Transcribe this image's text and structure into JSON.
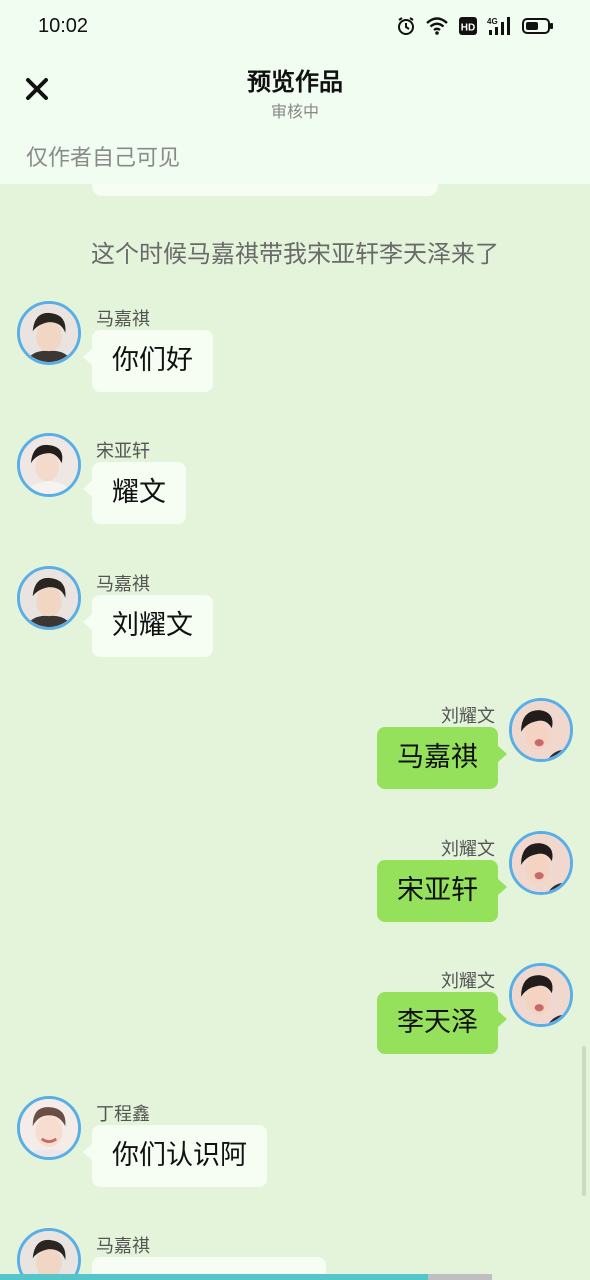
{
  "status_bar": {
    "time": "10:02",
    "icons": [
      "alarm-icon",
      "wifi-icon",
      "hd-icon",
      "signal-4g-icon",
      "battery-icon"
    ],
    "network_label": "4G",
    "hd_label": "HD"
  },
  "header": {
    "close_icon": "close-icon",
    "title": "预览作品",
    "subtitle": "审核中",
    "visibility_note": "仅作者自己可见"
  },
  "narration": "这个时候马嘉祺带我宋亚轩李天泽来了",
  "messages": [
    {
      "side": "left",
      "sender": "马嘉祺",
      "text": "你们好",
      "avatar": "avatar-majiaqi"
    },
    {
      "side": "left",
      "sender": "宋亚轩",
      "text": "耀文",
      "avatar": "avatar-songyaxuan"
    },
    {
      "side": "left",
      "sender": "马嘉祺",
      "text": "刘耀文",
      "avatar": "avatar-majiaqi"
    },
    {
      "side": "right",
      "sender": "刘耀文",
      "text": "马嘉祺",
      "avatar": "avatar-liuyaowen"
    },
    {
      "side": "right",
      "sender": "刘耀文",
      "text": "宋亚轩",
      "avatar": "avatar-liuyaowen"
    },
    {
      "side": "right",
      "sender": "刘耀文",
      "text": "李天泽",
      "avatar": "avatar-liuyaowen"
    },
    {
      "side": "left",
      "sender": "丁程鑫",
      "text": "你们认识阿",
      "avatar": "avatar-dingchengxin"
    },
    {
      "side": "left",
      "sender": "马嘉祺",
      "text": "",
      "avatar": "avatar-majiaqi"
    }
  ],
  "playback_progress": 0.87,
  "colors": {
    "background": "#e3f4da",
    "header": "#f1fdf0",
    "bubble_left": "#f6fdf3",
    "bubble_right": "#95e15b",
    "avatar_ring": "#5aaee6",
    "progress": "#54c6c9"
  }
}
